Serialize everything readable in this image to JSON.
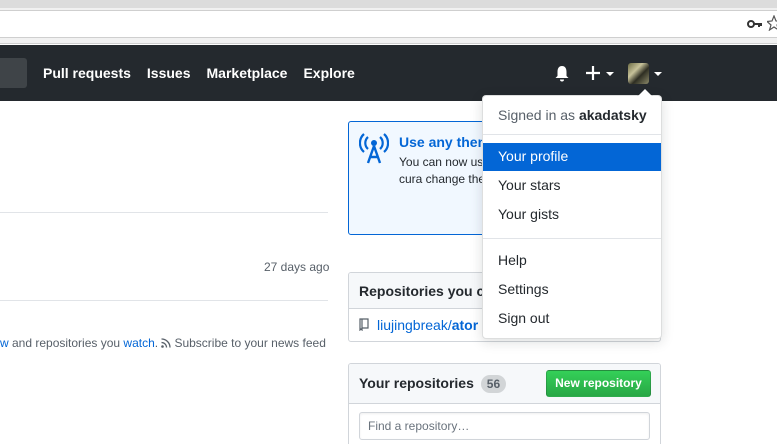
{
  "browser": {
    "icons": [
      "key-icon",
      "star-icon"
    ]
  },
  "header": {
    "nav": [
      "Pull requests",
      "Issues",
      "Marketplace",
      "Explore"
    ],
    "icons": [
      "bell-icon",
      "plus-icon",
      "avatar"
    ]
  },
  "feed": {
    "time_ago": "27 days ago",
    "line_prefix": "w",
    "line_mid": " and repositories you ",
    "line_watch": "watch",
    "line_dot": ".",
    "line_subscribe": "Subscribe to your news feed"
  },
  "promo": {
    "title": "Use any them",
    "body": "You can now use community-cura change the look site."
  },
  "contrib": {
    "title": "Repositories you co",
    "repo_owner": "liujingbreak/",
    "repo_name": "ator"
  },
  "yours": {
    "title": "Your repositories",
    "count": "56",
    "new_button": "New repository",
    "search_placeholder": "Find a repository…"
  },
  "dropdown": {
    "signed_in_prefix": "Signed in as ",
    "username": "akadatsky",
    "items_group1": [
      "Your profile",
      "Your stars",
      "Your gists"
    ],
    "items_group2": [
      "Help",
      "Settings",
      "Sign out"
    ],
    "active_item": "Your profile"
  },
  "colors": {
    "header_bg": "#24292e",
    "link": "#0366d6",
    "active_bg": "#0366d6",
    "button_green": "#28a745"
  }
}
